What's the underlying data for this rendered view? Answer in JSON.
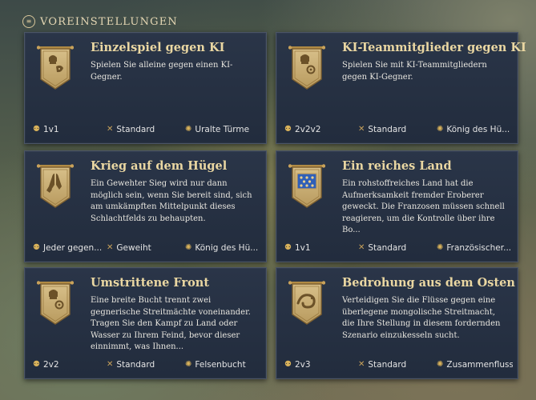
{
  "header": {
    "title": "VOREINSTELLUNGEN",
    "icon": "presets-icon"
  },
  "colors": {
    "card_bg": "#262f42",
    "title": "#ead7a2",
    "text": "#e8e6df",
    "gold": "#d9b25a"
  },
  "cards": [
    {
      "title": "Einzelspiel gegen KI",
      "desc": "Spielen Sie alleine gegen einen KI-Gegner.",
      "emblem": "helmet-mask-emblem",
      "players": "1v1",
      "difficulty": "Standard",
      "map": "Uralte Türme"
    },
    {
      "title": "KI-Teammitglieder gegen KI",
      "desc": "Spielen Sie mit KI-Teammitgliedern gegen KI-Gegner.",
      "emblem": "helmet-gears-emblem",
      "players": "2v2v2",
      "difficulty": "Standard",
      "map": "König des Hü..."
    },
    {
      "title": "Krieg auf dem Hügel",
      "desc": "Ein Gewehter Sieg wird nur dann möglich sein, wenn Sie bereit sind, sich am umkämpften Mittelpunkt dieses Schlachtfelds zu behaupten.",
      "emblem": "praying-hands-emblem",
      "players": "Jeder gegen...",
      "difficulty": "Geweiht",
      "map": "König des Hü..."
    },
    {
      "title": "Ein reiches Land",
      "desc": "Ein rohstoffreiches Land hat die Aufmerksamkeit fremder Eroberer geweckt. Die Franzosen müssen schnell reagieren, um die Kontrolle über ihre Bo...",
      "emblem": "french-banner-emblem",
      "players": "1v1",
      "difficulty": "Standard",
      "map": "Französischer..."
    },
    {
      "title": "Umstrittene Front",
      "desc": "Eine breite Bucht trennt zwei gegnerische Streitmächte voneinander. Tragen Sie den Kampf zu Land oder Wasser zu Ihrem Feind, bevor dieser einnimmt, was Ihnen...",
      "emblem": "helmet-gears-emblem",
      "players": "2v2",
      "difficulty": "Standard",
      "map": "Felsenbucht"
    },
    {
      "title": "Bedrohung aus dem Osten",
      "desc": "Verteidigen Sie die Flüsse gegen eine überlegene mongolische Streitmacht, die Ihre Stellung in diesem fordernden Szenario einzukesseln sucht.",
      "emblem": "river-serpent-emblem",
      "players": "2v3",
      "difficulty": "Standard",
      "map": "Zusammenfluss"
    }
  ]
}
